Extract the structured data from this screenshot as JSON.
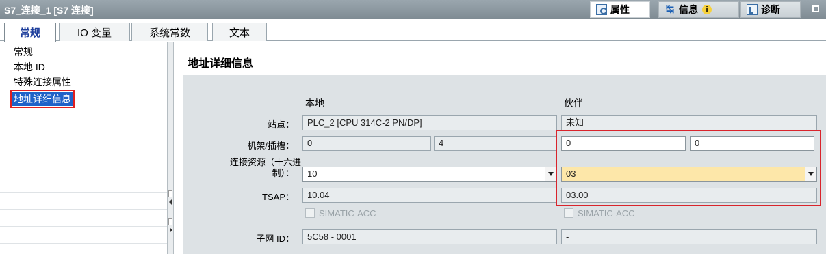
{
  "window": {
    "title": "S7_连接_1 [S7 连接]"
  },
  "inspector_tabs": {
    "properties": "属性",
    "info": "信息",
    "diagnostics": "诊断"
  },
  "sub_tabs": [
    "常规",
    "IO 变量",
    "系统常数",
    "文本"
  ],
  "nav": {
    "items": [
      "常规",
      "本地 ID",
      "特殊连接属性",
      "地址详细信息"
    ]
  },
  "section": {
    "title": "地址详细信息"
  },
  "columns": {
    "local": "本地",
    "partner": "伙伴"
  },
  "labels": {
    "station": "站点：",
    "rack_slot": "机架/插槽：",
    "conn_resource_line1": "连接资源（十六进",
    "conn_resource_line2": "制）：",
    "tsap": "TSAP：",
    "subnet_id": "子网 ID："
  },
  "local": {
    "station": "PLC_2 [CPU 314C-2 PN/DP]",
    "rack": "0",
    "slot": "4",
    "conn_resource": "10",
    "tsap": "10.04",
    "simatic_acc": "SIMATIC-ACC",
    "subnet_id": "5C58 - 0001"
  },
  "partner": {
    "station": "未知",
    "rack": "0",
    "slot": "0",
    "conn_resource": "03",
    "tsap": "03.00",
    "simatic_acc": "SIMATIC-ACC",
    "subnet_id": "-"
  },
  "colors": {
    "highlight": "#d9242c",
    "selected": "#1f62c8",
    "editable_highlight": "#fde7a9"
  }
}
